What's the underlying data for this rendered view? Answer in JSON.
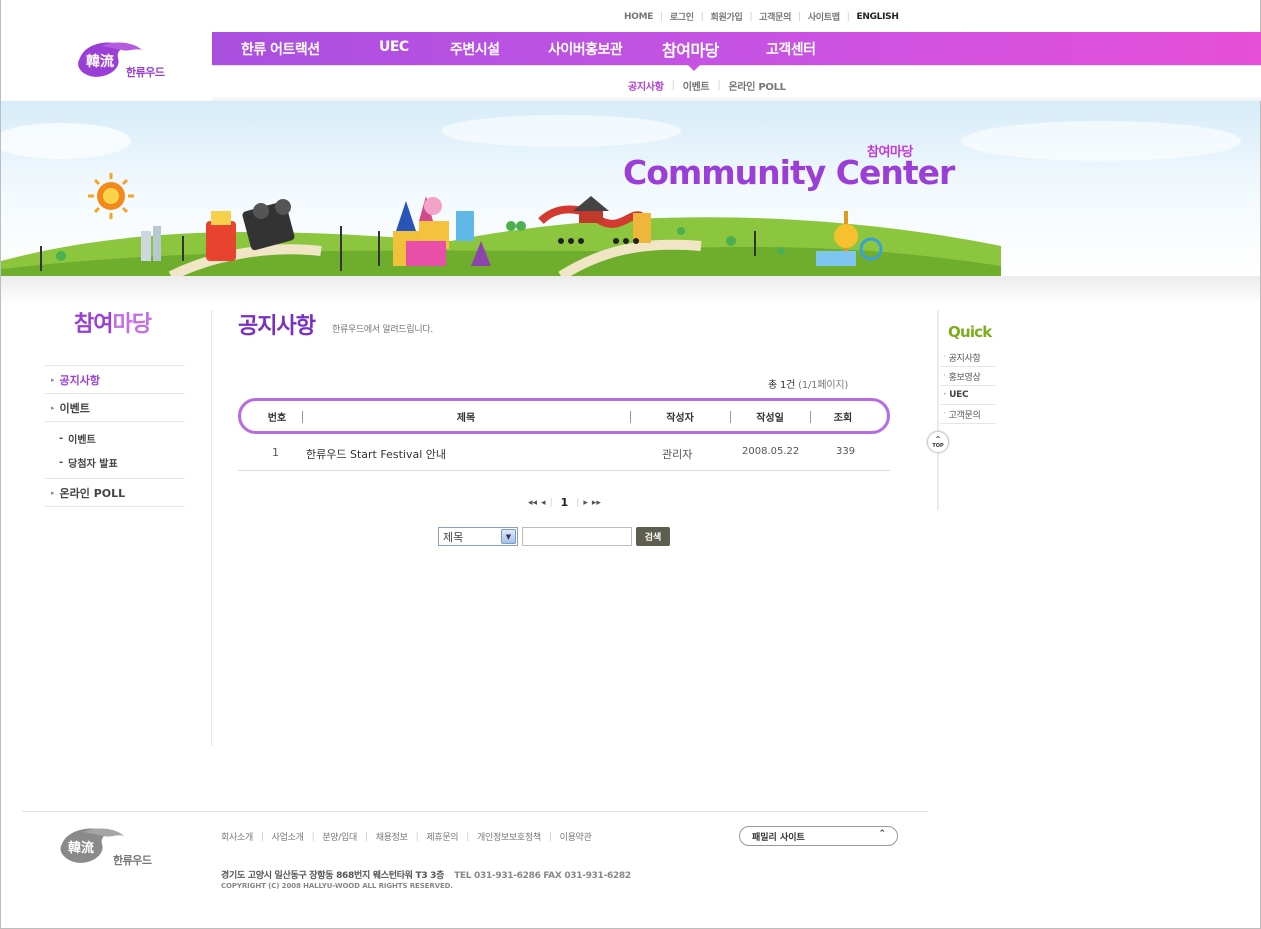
{
  "util_links": [
    "HOME",
    "로그인",
    "회원가입",
    "고객문의",
    "사이트맵",
    "ENGLISH"
  ],
  "logo_text": "한류우드",
  "main_nav": [
    "한류 어트랙션",
    "UEC",
    "주변시설",
    "사이버홍보관",
    "참여마당",
    "고객센터"
  ],
  "main_nav_active": "참여마당",
  "sub_nav": [
    "공지사항",
    "이벤트",
    "온라인 POLL"
  ],
  "banner": {
    "subtitle": "참여마당",
    "title": "Community Center"
  },
  "sidebar": {
    "title_bold": "참여",
    "title_light": "마당",
    "items": [
      {
        "label": "공지사항",
        "active": true
      },
      {
        "label": "이벤트"
      },
      {
        "label": "온라인 POLL"
      }
    ],
    "sub_items": [
      "이벤트",
      "당첨자 발표"
    ]
  },
  "content": {
    "title": "공지사항",
    "description": "한류우드에서 알려드립니다.",
    "count_label": "총 1건",
    "count_page": "(1/1페이지)",
    "columns": [
      "번호",
      "제목",
      "작성자",
      "작성일",
      "조회"
    ],
    "rows": [
      {
        "no": "1",
        "title": "한류우드 Start Festival 안내",
        "author": "관리자",
        "date": "2008.05.22",
        "views": "339"
      }
    ],
    "pager": {
      "first": "◂◂",
      "prev": "◂",
      "current": "1",
      "next": "▸",
      "last": "▸▸"
    },
    "search": {
      "select_value": "제목",
      "button": "검색"
    }
  },
  "quick": {
    "title": "Quick",
    "items": [
      "공지사항",
      "홍보영상",
      "UEC",
      "고객문의"
    ],
    "top_label": "TOP"
  },
  "footer": {
    "links": [
      "회사소개",
      "사업소개",
      "분양/입대",
      "채용정보",
      "제휴문의",
      "개인정보보호정책",
      "이용약관"
    ],
    "family_site": "패밀리 사이트",
    "address": "경기도 고양시 일산동구 장항동 868번지 웨스턴타워 T3 3층",
    "tel": "TEL 031-931-6286  FAX 031-931-6282",
    "copyright": "COPYRIGHT (C) 2008 HALLYU-WOOD ALL RIGHTS RESERVED."
  },
  "colors": {
    "brand_purple": "#9a3ed6",
    "nav_gradient_start": "#a94fe0",
    "nav_gradient_end": "#e64fd8",
    "quick_green": "#7dac1c"
  }
}
